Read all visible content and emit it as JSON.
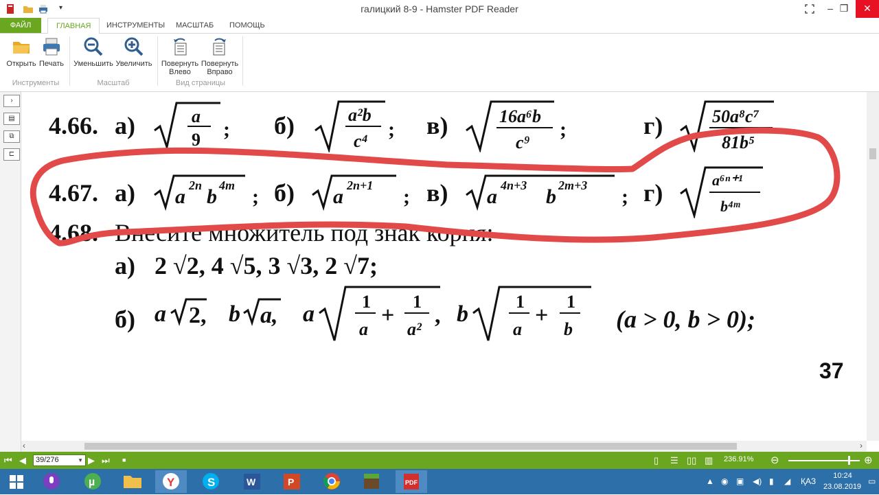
{
  "window": {
    "title": "галицкий 8-9 - Hamster PDF Reader",
    "minimize_icon": "fullscreen-icon",
    "colors": {
      "accent": "#6aa61f",
      "close": "#e81123",
      "taskbar": "#2d6fa8",
      "annotation": "#e24a4a"
    }
  },
  "ribbon": {
    "tabs": [
      {
        "label": "ФАЙЛ"
      },
      {
        "label": "ГЛАВНАЯ"
      },
      {
        "label": "ИНСТРУМЕНТЫ"
      },
      {
        "label": "МАСШТАБ"
      },
      {
        "label": "ПОМОЩЬ"
      }
    ],
    "buttons": {
      "open": "Открыть",
      "print": "Печать",
      "zoom_out": "Уменьшить",
      "zoom_in": "Увеличить",
      "rotate_left_1": "Повернуть",
      "rotate_left_2": "Влево",
      "rotate_right_1": "Повернуть",
      "rotate_right_2": "Вправо"
    },
    "groups": {
      "tools": "Инструменты",
      "zoom": "Масштаб",
      "page_view": "Вид страницы"
    }
  },
  "document": {
    "ex_466": {
      "num": "4.66.",
      "a": "а)",
      "b": "б)",
      "v": "в)",
      "g": "г)"
    },
    "ex_467": {
      "num": "4.67.",
      "a": "а)",
      "b": "б)",
      "v": "в)",
      "g": "г)"
    },
    "ex_468": {
      "num": "4.68.",
      "text": "Внесите множитель под знак корня:",
      "a_label": "а)",
      "a_items": "2 √2, 4 √5, 3 √3, 2 √7;",
      "b_label": "б)",
      "b_tail": "(a > 0, b > 0);"
    },
    "page_number": "37"
  },
  "statusbar": {
    "page": "39/276",
    "zoom": "236.91%"
  },
  "taskbar": {
    "language": "ҚАЗ",
    "time": "10:24",
    "date": "23.08.2019"
  }
}
